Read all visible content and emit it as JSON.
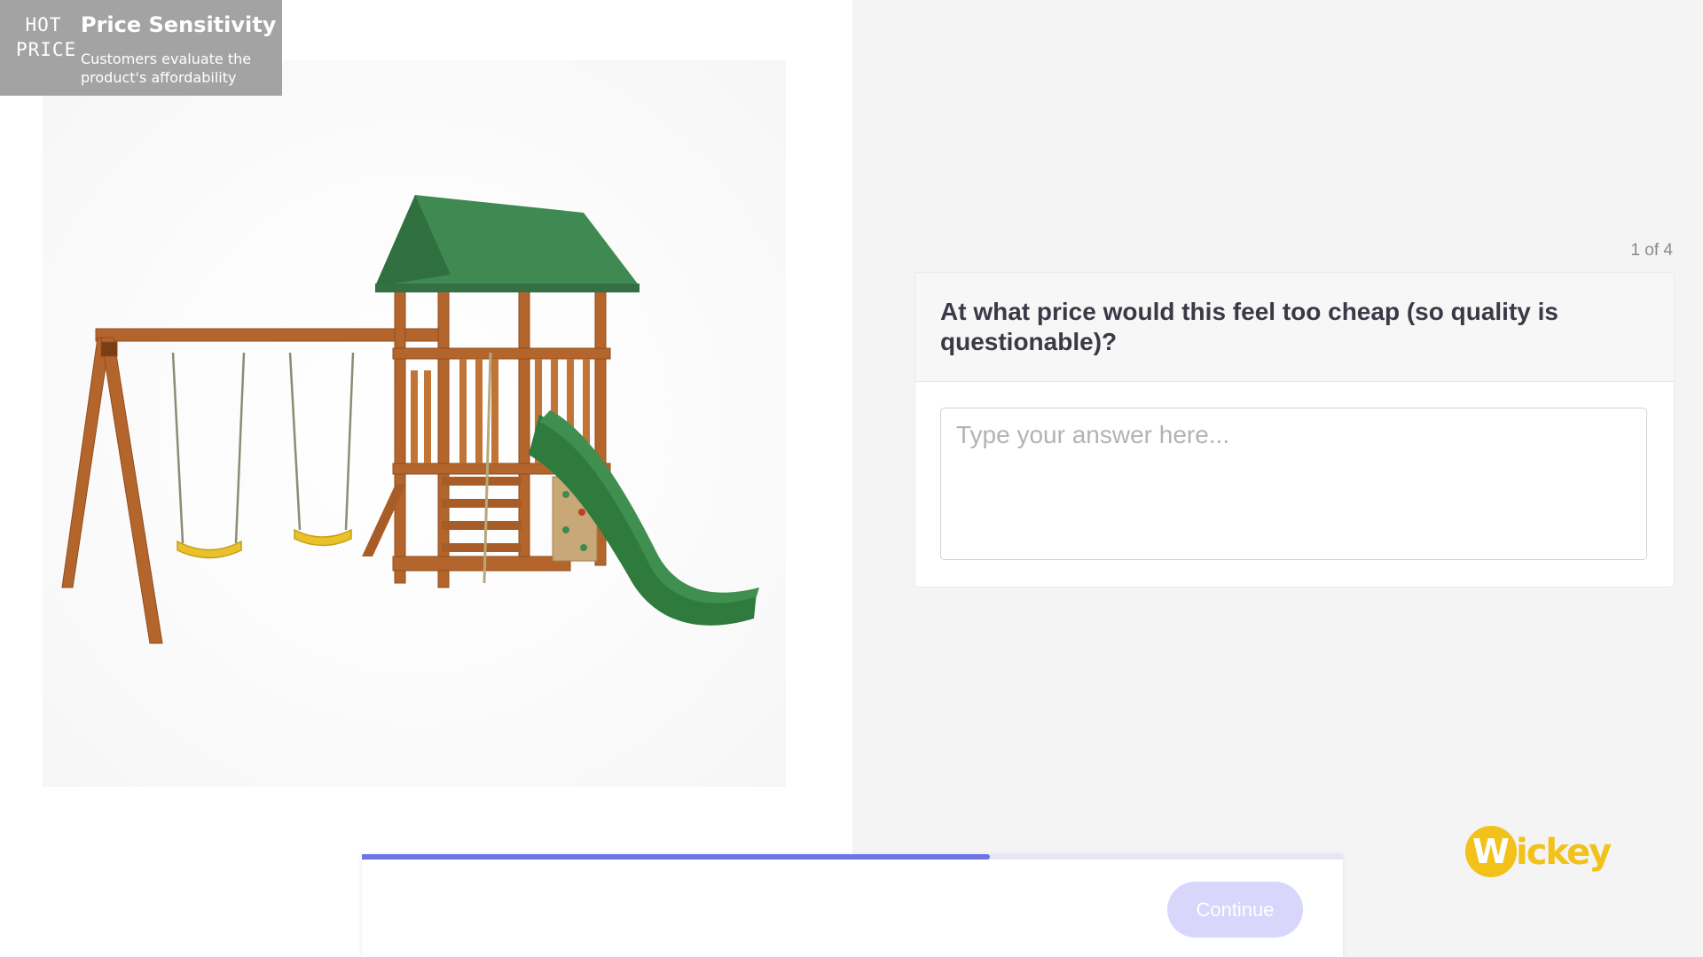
{
  "badge": {
    "logo_line1": "HOT",
    "logo_line2": "PRICE",
    "title": "Price Sensitivity",
    "description": "Customers evaluate the product's affordability"
  },
  "progress": {
    "counter": "1 of 4",
    "fraction": 0.64
  },
  "question": {
    "text": "At what price would this feel too cheap (so quality is questionable)?",
    "answer_value": "",
    "answer_placeholder": "Type your answer here..."
  },
  "footer": {
    "continue_label": "Continue"
  },
  "brand": {
    "name": "Wickey",
    "color": "#f2c11a"
  },
  "colors": {
    "accent": "#6d72e4",
    "button_disabled": "#d8d6fb",
    "canopy_green": "#3f8a52",
    "wood": "#b4652c",
    "swing_seat": "#e8c12b"
  },
  "image": {
    "subject": "wooden-playset-with-swings-and-green-slide"
  }
}
